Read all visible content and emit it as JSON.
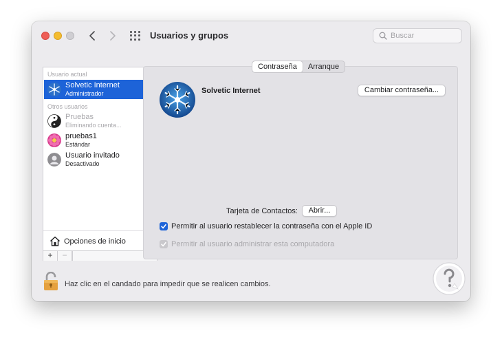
{
  "window": {
    "title": "Usuarios y grupos"
  },
  "search": {
    "placeholder": "Buscar"
  },
  "sidebar": {
    "current_user_header": "Usuario actual",
    "other_users_header": "Otros usuarios",
    "users": [
      {
        "name": "Solvetic Internet",
        "role": "Administrador",
        "selected": true
      },
      {
        "name": "Pruebas",
        "role": "Eliminando cuenta...",
        "selected": false
      },
      {
        "name": "pruebas1",
        "role": "Estándar",
        "selected": false
      },
      {
        "name": "Usuario invitado",
        "role": "Desactivado",
        "selected": false
      }
    ],
    "login_options_label": "Opciones de inicio",
    "add_label": "+",
    "remove_label": "−"
  },
  "tabs": [
    {
      "label": "Contraseña",
      "active": true
    },
    {
      "label": "Arranque",
      "active": false
    }
  ],
  "detail": {
    "user_name": "Solvetic Internet",
    "change_password_button": "Cambiar contraseña...",
    "contacts_label": "Tarjeta de Contactos:",
    "open_button": "Abrir...",
    "checkbox_reset": {
      "label": "Permitir al usuario restablecer la contraseña con el Apple ID",
      "checked": true
    },
    "checkbox_admin": {
      "label": "Permitir al usuario administrar esta computadora",
      "checked": true,
      "disabled": true
    }
  },
  "footer": {
    "lock_text": "Haz clic en el candado para impedir que se realicen cambios."
  },
  "colors": {
    "accent": "#1d63d8",
    "window_bg": "#ecebee",
    "panel_bg": "#e3e2e6"
  },
  "icons": [
    "back-chevron-icon",
    "forward-chevron-icon",
    "grid-icon",
    "search-icon",
    "home-icon",
    "lock-icon"
  ]
}
